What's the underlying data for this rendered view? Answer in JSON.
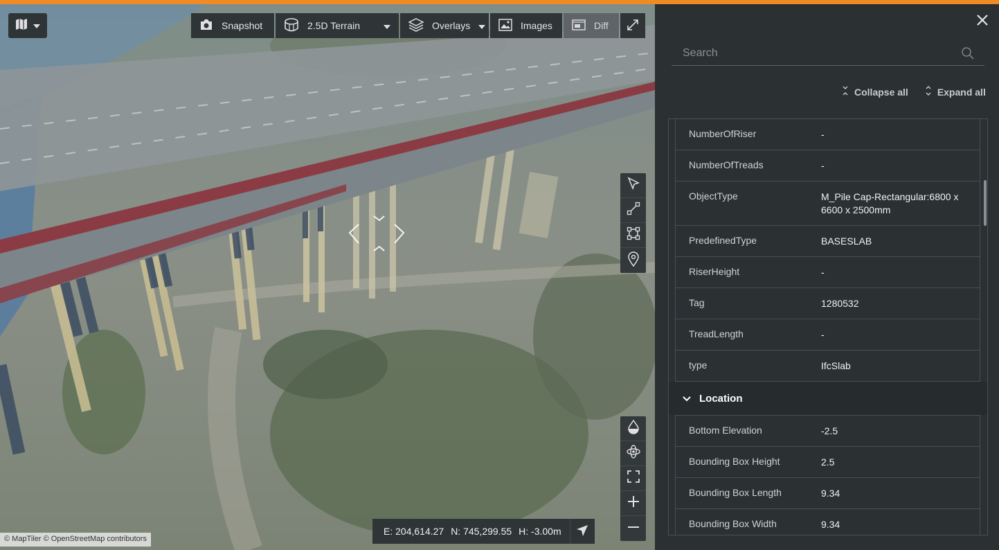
{
  "colors": {
    "accent": "#f08a24",
    "panel_bg": "#2b3033",
    "toolbar_bg": "#2f3437"
  },
  "map_toolbar": {
    "map_style_icon": "map-icon",
    "buttons": [
      {
        "icon": "camera-icon",
        "label": "Snapshot"
      },
      {
        "icon": "terrain-icon",
        "label": "2.5D Terrain",
        "dropdown": true
      },
      {
        "icon": "layers-icon",
        "label": "Overlays",
        "dropdown": true
      },
      {
        "icon": "image-icon",
        "label": "Images"
      },
      {
        "icon": "diff-icon",
        "label": "Diff",
        "active": true
      }
    ],
    "fullscreen_icon": "expand-icon"
  },
  "tools_top": [
    "select-arrow-icon",
    "measure-line-icon",
    "measure-area-icon",
    "location-pin-icon"
  ],
  "tools_bottom": [
    "water-drop-icon",
    "orbit-icon",
    "fit-view-icon",
    "zoom-in-icon",
    "zoom-out-icon"
  ],
  "coords": {
    "e": "E: 204,614.27",
    "n": "N: 745,299.55",
    "h": "H: -3.00m"
  },
  "attribution": "© MapTiler © OpenStreetMap contributors",
  "panel": {
    "search_placeholder": "Search",
    "collapse_all": "Collapse all",
    "expand_all": "Expand all",
    "properties": [
      {
        "key": "NumberOfRiser",
        "value": "-"
      },
      {
        "key": "NumberOfTreads",
        "value": "-"
      },
      {
        "key": "ObjectType",
        "value": "M_Pile Cap-Rectangular:6800 x 6600 x 2500mm"
      },
      {
        "key": "PredefinedType",
        "value": "BASESLAB"
      },
      {
        "key": "RiserHeight",
        "value": "-"
      },
      {
        "key": "Tag",
        "value": "1280532"
      },
      {
        "key": "TreadLength",
        "value": "-"
      },
      {
        "key": "type",
        "value": "IfcSlab"
      }
    ],
    "location_section": "Location",
    "location": [
      {
        "key": "Bottom Elevation",
        "value": "-2.5"
      },
      {
        "key": "Bounding Box Height",
        "value": "2.5"
      },
      {
        "key": "Bounding Box Length",
        "value": "9.34"
      },
      {
        "key": "Bounding Box Width",
        "value": "9.34"
      }
    ]
  }
}
